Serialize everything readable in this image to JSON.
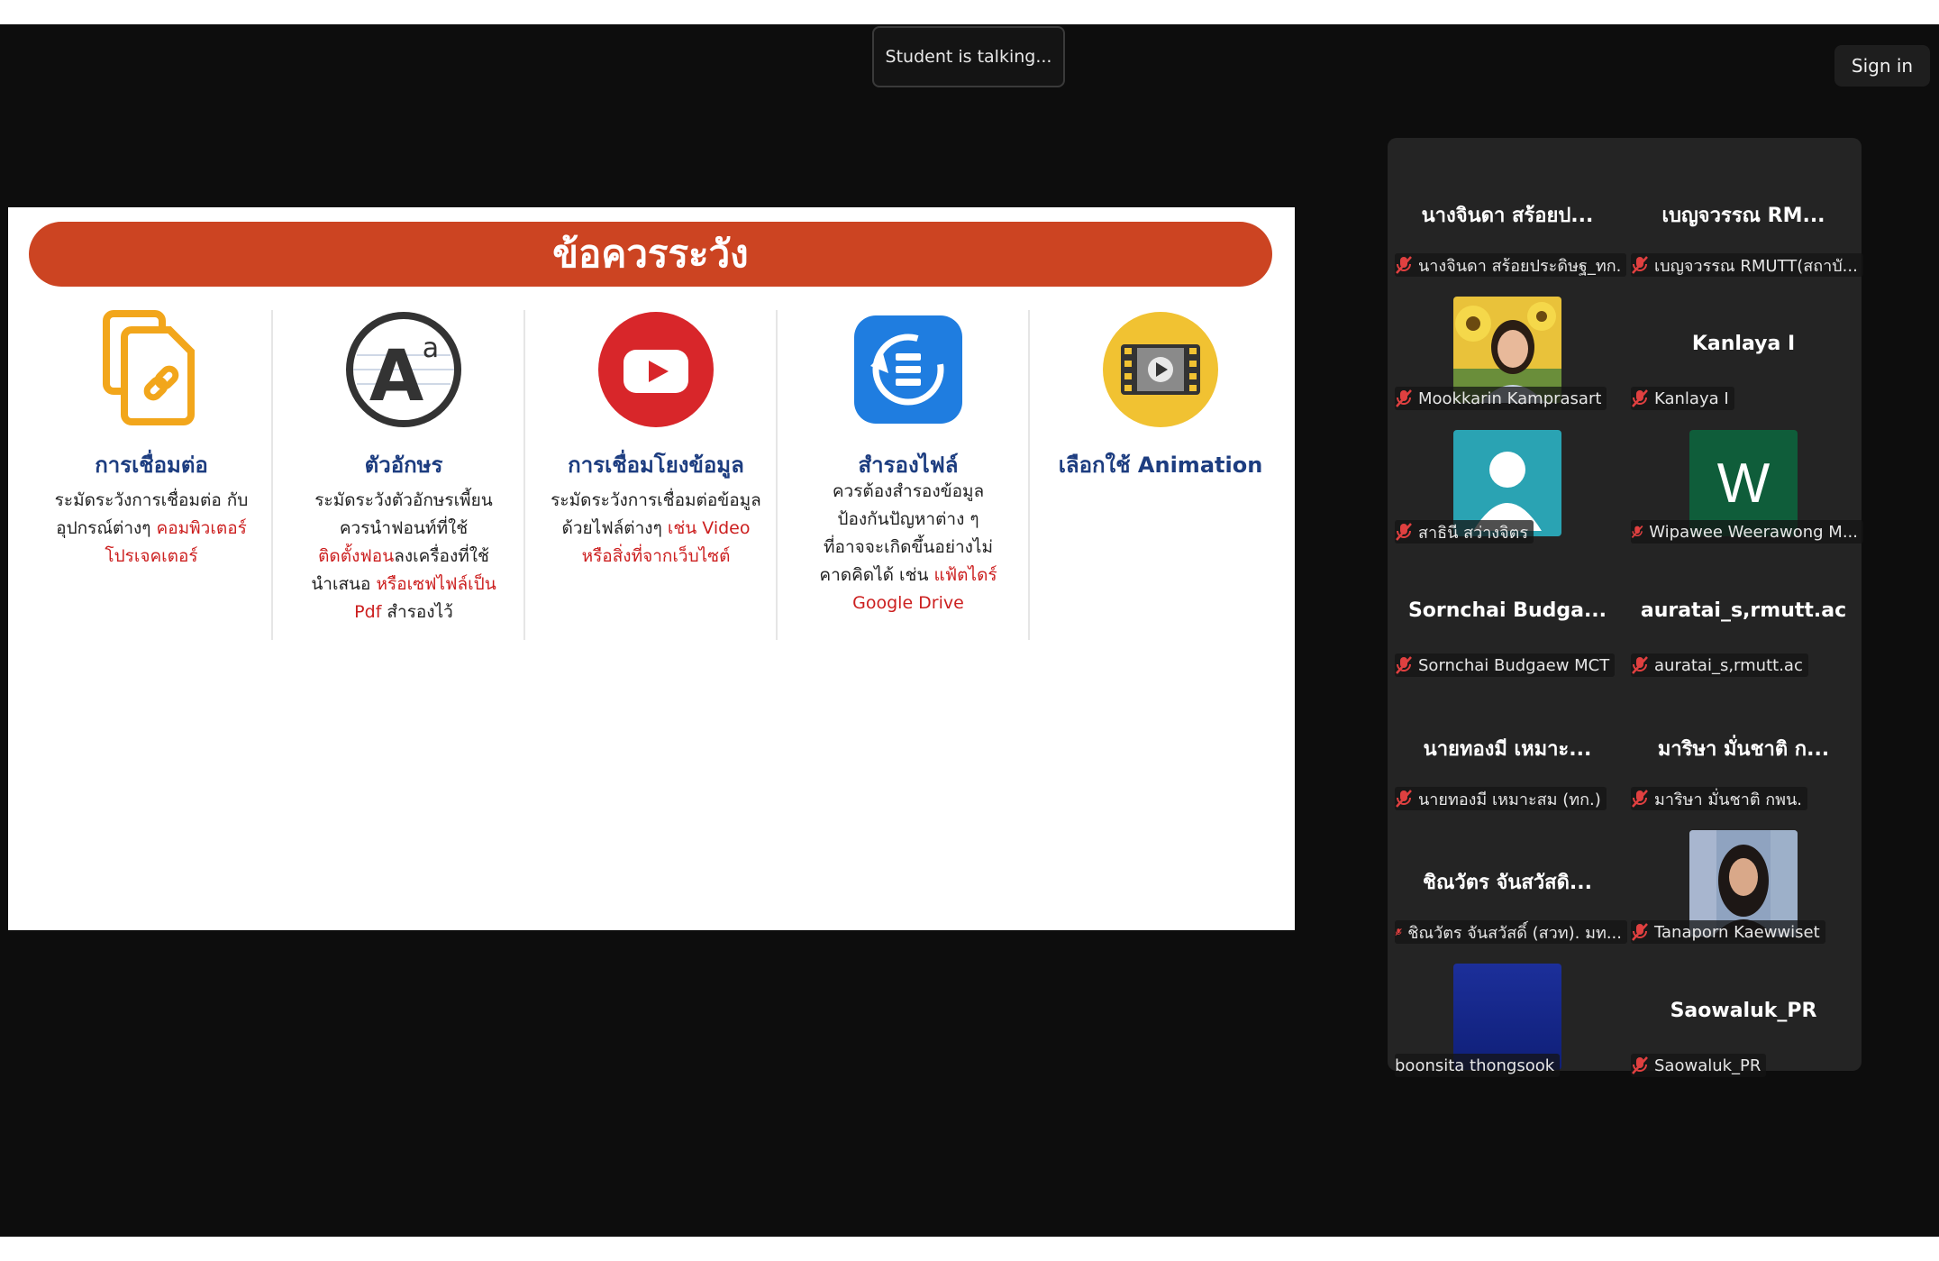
{
  "meeting": {
    "talking_text": "Student is talking...",
    "sign_in_label": "Sign in"
  },
  "slide": {
    "banner": "ข้อควรระวัง",
    "columns": [
      {
        "title": "การเชื่อมต่อ",
        "desc_lines": [
          {
            "text": "ระมัดระวังการเชื่อมต่อ กับ",
            "hl": ""
          },
          {
            "text": "อุปกรณ์ต่างๆ ",
            "hl": "คอมพิวเตอร์"
          },
          {
            "text": "",
            "hl": "โปรเจคเตอร์"
          }
        ]
      },
      {
        "title": "ตัวอักษร",
        "desc_lines": [
          {
            "text": "ระมัดระวังตัวอักษรเพี้ยน",
            "hl": ""
          },
          {
            "text": "ควรนำฟอนท์ที่ใช้",
            "hl": ""
          },
          {
            "hl": "ติดตั้งฟอน",
            "text": "ลงเครื่องที่ใช้"
          },
          {
            "text": "นำเสนอ ",
            "hl": "หรือเซฟไฟล์เป็น"
          },
          {
            "hl": "Pdf",
            "text": " สำรองไว้"
          }
        ]
      },
      {
        "title": "การเชื่อมโยงข้อมูล",
        "desc_lines": [
          {
            "text": "ระมัดระวังการเชื่อมต่อข้อมูล",
            "hl": ""
          },
          {
            "text": "ด้วยไฟล์ต่างๆ ",
            "hl": "เช่น Video"
          },
          {
            "text": "",
            "hl": "หรือสิ่งที่จากเว็บไซต์"
          }
        ]
      },
      {
        "title": "สำรองไฟล์",
        "desc_lines": [
          {
            "text": "ควรต้องสำรองข้อมูล",
            "hl": ""
          },
          {
            "text": "ป้องกันปัญหาต่าง ๆ",
            "hl": ""
          },
          {
            "text": "ที่อาจจะเกิดขึ้นอย่างไม่",
            "hl": ""
          },
          {
            "text": "คาดคิดได้ เช่น ",
            "hl": "แฟ้ตไดร์"
          },
          {
            "text": "",
            "hl": "Google Drive"
          }
        ]
      },
      {
        "title": "เลือกใช้ Animation",
        "desc_lines": []
      }
    ],
    "icons": [
      "link-file-icon",
      "font-icon",
      "youtube-icon",
      "backup-icon",
      "film-icon"
    ]
  },
  "participants": [
    {
      "display": "นางจินดา สร้อยป...",
      "label": "นางจินดา สร้อยประดิษฐ_ทก.",
      "muted": true,
      "avatar": "none"
    },
    {
      "display": "เบญจวรรณ RM...",
      "label": "เบญจวรรณ RMUTT(สถาบั...",
      "muted": true,
      "avatar": "none"
    },
    {
      "display": "",
      "label": "Mookkarin Kamprasart",
      "muted": true,
      "avatar": "photo-sunflower"
    },
    {
      "display": "Kanlaya I",
      "label": "Kanlaya I",
      "muted": true,
      "avatar": "none"
    },
    {
      "display": "",
      "label": "สาธินี สว่างจิตร",
      "muted": true,
      "avatar": "default-person"
    },
    {
      "display": "",
      "label": "Wipawee Weerawong M...",
      "muted": true,
      "avatar": "letter",
      "letter": "W"
    },
    {
      "display": "Sornchai Budga...",
      "label": "Sornchai Budgaew MCT",
      "muted": true,
      "avatar": "none"
    },
    {
      "display": "auratai_s,rmutt.ac",
      "label": "auratai_s,rmutt.ac",
      "muted": true,
      "avatar": "none"
    },
    {
      "display": "นายทองมี เหมาะ...",
      "label": "นายทองมี เหมาะสม (ทก.)",
      "muted": true,
      "avatar": "none"
    },
    {
      "display": "มาริษา มั่นชาติ ก...",
      "label": "มาริษา มั่นชาติ กพน.",
      "muted": true,
      "avatar": "none"
    },
    {
      "display": "ชิณวัตร จันสวัสดิ...",
      "label": "ชิณวัตร จันสวัสดิ์ (สวท). มท...",
      "muted": true,
      "avatar": "none"
    },
    {
      "display": "",
      "label": "Tanaporn Kaewwiset",
      "muted": true,
      "avatar": "photo-woman"
    },
    {
      "display": "",
      "label": "boonsita thongsook",
      "muted": false,
      "avatar": "blue"
    },
    {
      "display": "Saowaluk_PR",
      "label": "Saowaluk_PR",
      "muted": true,
      "avatar": "none"
    }
  ],
  "colors": {
    "banner": "#cc4422",
    "title": "#1d3d80",
    "highlight": "#cc1f1f",
    "mic_muted": "#e04040",
    "gallery_bg": "#242424"
  }
}
